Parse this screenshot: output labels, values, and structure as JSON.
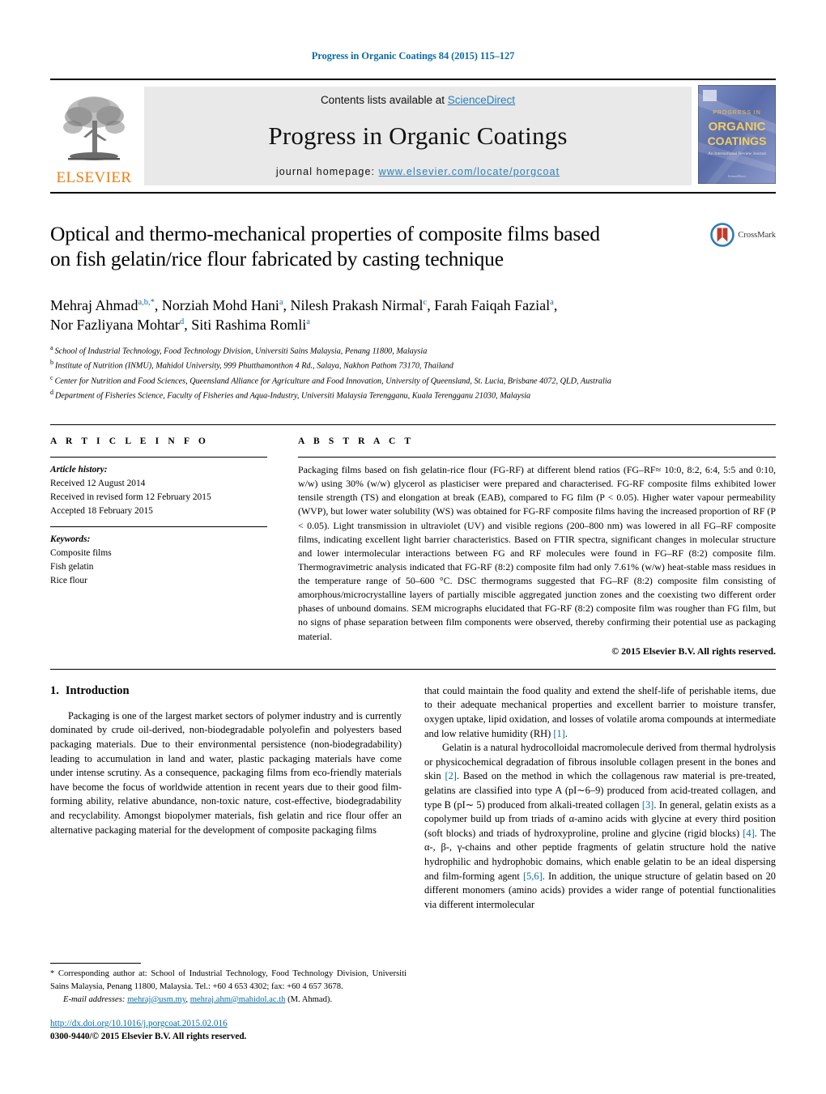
{
  "running_head": "Progress in Organic Coatings 84 (2015) 115–127",
  "banner": {
    "publisher_name": "ELSEVIER",
    "contents_prefix": "Contents lists available at ",
    "contents_link": "ScienceDirect",
    "journal_title": "Progress in Organic Coatings",
    "homepage_label": "journal homepage:",
    "homepage_url": "www.elsevier.com/locate/porgcoat",
    "cover": {
      "line1": "PROGRESS IN",
      "line2": "ORGANIC",
      "line3": "COATINGS",
      "line4": "An International Review Journal"
    }
  },
  "article": {
    "title_line1": "Optical and thermo-mechanical properties of composite films based",
    "title_line2": "on fish gelatin/rice flour fabricated by casting technique",
    "crossmark_label": "CrossMark",
    "authors": [
      {
        "name": "Mehraj Ahmad",
        "marks": "a,b,*",
        "sep": ", "
      },
      {
        "name": "Norziah Mohd Hani",
        "marks": "a",
        "sep": ", "
      },
      {
        "name": "Nilesh Prakash Nirmal",
        "marks": "c",
        "sep": ", "
      },
      {
        "name": "Farah Faiqah Fazial",
        "marks": "a",
        "sep": ", "
      },
      {
        "name": "Nor Fazliyana Mohtar",
        "marks": "d",
        "sep": ", "
      },
      {
        "name": "Siti Rashima Romli",
        "marks": "a",
        "sep": ""
      }
    ],
    "affiliations": [
      {
        "mark": "a",
        "text": "School of Industrial Technology, Food Technology Division, Universiti Sains Malaysia, Penang 11800, Malaysia"
      },
      {
        "mark": "b",
        "text": "Institute of Nutrition (INMU), Mahidol University, 999 Phutthamonthon 4 Rd., Salaya, Nakhon Pathom 73170, Thailand"
      },
      {
        "mark": "c",
        "text": "Center for Nutrition and Food Sciences, Queensland Alliance for Agriculture and Food Innovation, University of Queensland, St. Lucia, Brisbane 4072, QLD, Australia"
      },
      {
        "mark": "d",
        "text": "Department of Fisheries Science, Faculty of Fisheries and Aqua-Industry, Universiti Malaysia Terengganu, Kuala Terengganu 21030, Malaysia"
      }
    ]
  },
  "article_info": {
    "heading": "A R T I C L E    I N F O",
    "history_label": "Article history:",
    "history": [
      "Received 12 August 2014",
      "Received in revised form 12 February 2015",
      "Accepted 18 February 2015"
    ],
    "keywords_label": "Keywords:",
    "keywords": [
      "Composite films",
      "Fish gelatin",
      "Rice flour"
    ]
  },
  "abstract": {
    "heading": "A B S T R A C T",
    "text": "Packaging films based on fish gelatin-rice flour (FG-RF) at different blend ratios (FG–RF≈ 10:0, 8:2, 6:4, 5:5 and 0:10, w/w) using 30% (w/w) glycerol as plasticiser were prepared and characterised. FG-RF composite films exhibited lower tensile strength (TS) and elongation at break (EAB), compared to FG film (P < 0.05). Higher water vapour permeability (WVP), but lower water solubility (WS) was obtained for FG-RF composite films having the increased proportion of RF (P < 0.05). Light transmission in ultraviolet (UV) and visible regions (200–800 nm) was lowered in all FG–RF composite films, indicating excellent light barrier characteristics. Based on FTIR spectra, significant changes in molecular structure and lower intermolecular interactions between FG and RF molecules were found in FG–RF (8:2) composite film. Thermogravimetric analysis indicated that FG-RF (8:2) composite film had only 7.61% (w/w) heat-stable mass residues in the temperature range of 50–600 °C. DSC thermograms suggested that FG–RF (8:2) composite film consisting of amorphous/microcrystalline layers of partially miscible aggregated junction zones and the coexisting two different order phases of unbound domains. SEM micrographs elucidated that FG-RF (8:2) composite film was rougher than FG film, but no signs of phase separation between film components were observed, thereby confirming their potential use as packaging material.",
    "copyright": "© 2015 Elsevier B.V. All rights reserved."
  },
  "introduction": {
    "number": "1.",
    "heading": "Introduction",
    "left_paragraph": "Packaging is one of the largest market sectors of polymer industry and is currently dominated by crude oil-derived, non-biodegradable polyolefin and polyesters based packaging materials. Due to their environmental persistence (non-biodegradability) leading to accumulation in land and water, plastic packaging materials have come under intense scrutiny. As a consequence, packaging films from eco-friendly materials have become the focus of worldwide attention in recent years due to their good film-forming ability, relative abundance, non-toxic nature, cost-effective, biodegradability and recyclability. Amongst biopolymer materials, fish gelatin and rice flour offer an alternative packaging material for the development of composite packaging films",
    "right_paragraph_1a": "that could maintain the food quality and extend the shelf-life of perishable items, due to their adequate mechanical properties and excellent barrier to moisture transfer, oxygen uptake, lipid oxidation, and losses of volatile aroma compounds at intermediate and low relative humidity (RH) ",
    "right_ref_1": "[1]",
    "right_paragraph_2a": "Gelatin is a natural hydrocolloidal macromolecule derived from thermal hydrolysis or physicochemical degradation of fibrous insoluble collagen present in the bones and skin ",
    "right_ref_2": "[2]",
    "right_paragraph_2b": ". Based on the method in which the collagenous raw material is pre-treated, gelatins are classified into type A (pI∼6–9) produced from acid-treated collagen, and type B (pI∼ 5) produced from alkali-treated collagen ",
    "right_ref_3": "[3]",
    "right_paragraph_2c": ". In general, gelatin exists as a copolymer build up from triads of α-amino acids with glycine at every third position (soft blocks) and triads of hydroxyproline, proline and glycine (rigid blocks) ",
    "right_ref_4": "[4]",
    "right_paragraph_2d": ". The α-, β-, γ-chains and other peptide fragments of gelatin structure hold the native hydrophilic and hydrophobic domains, which enable gelatin to be an ideal dispersing and film-forming agent ",
    "right_ref_56": "[5,6]",
    "right_paragraph_2e": ". In addition, the unique structure of gelatin based on 20 different monomers (amino acids) provides a wider range of potential functionalities via different intermolecular"
  },
  "footnote": {
    "star": "*",
    "corresponding": " Corresponding author at: School of Industrial Technology, Food Technology Division, Universiti Sains Malaysia, Penang 11800, Malaysia. Tel.: +60 4 653 4302; fax: +60 4 657 3678.",
    "email_label": "E-mail addresses:",
    "email_1": "mehraj@usm.my",
    "email_2": "mehraj.ahm@mahidol.ac.th",
    "email_suffix": "(M. Ahmad).",
    "doi": "http://dx.doi.org/10.1016/j.porgcoat.2015.02.016",
    "issn": "0300-9440/© 2015 Elsevier B.V. All rights reserved."
  },
  "colors": {
    "link": "#0b6da4",
    "sciencedirect": "#2a7fb8",
    "elsevier_orange": "#EE7D11",
    "banner_bg": "#e9e9e9",
    "crossmark_blue": "#2d7cb8",
    "crossmark_red": "#c0392b"
  }
}
